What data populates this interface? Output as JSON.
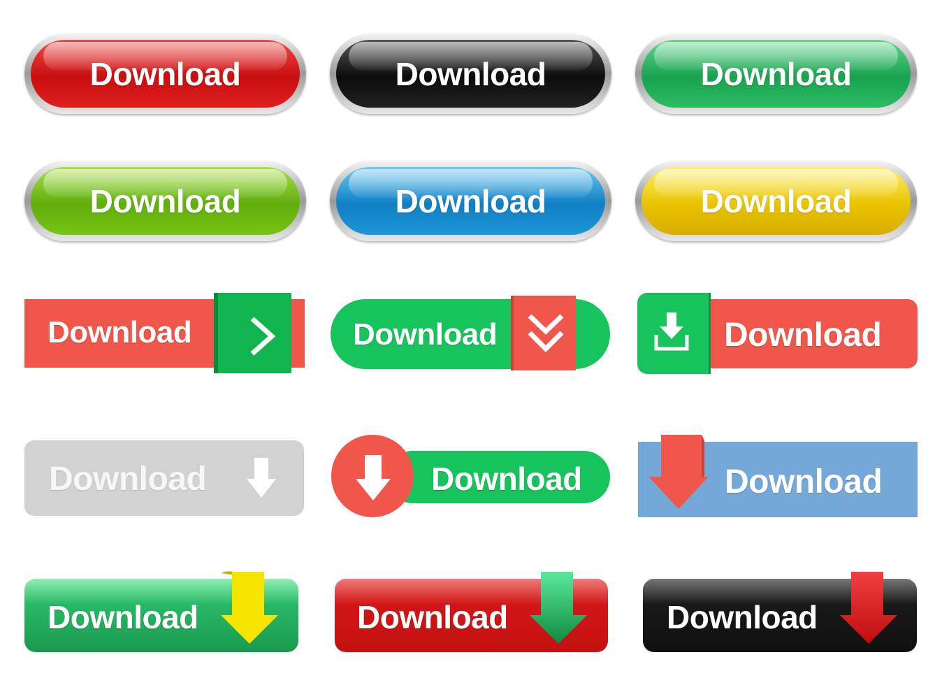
{
  "buttons": [
    {
      "label": "Download",
      "style": "glossy-pill",
      "color": "#d81818"
    },
    {
      "label": "Download",
      "style": "glossy-pill",
      "color": "#111111"
    },
    {
      "label": "Download",
      "style": "glossy-pill",
      "color": "#1fae55"
    },
    {
      "label": "Download",
      "style": "glossy-pill",
      "color": "#6fbe12"
    },
    {
      "label": "Download",
      "style": "glossy-pill",
      "color": "#1488cf"
    },
    {
      "label": "Download",
      "style": "glossy-pill",
      "color": "#efd000"
    },
    {
      "label": "Download",
      "style": "flat-tab",
      "color": "#f0574a",
      "icon": "chevron-right-icon"
    },
    {
      "label": "Download",
      "style": "flat-pill-tab",
      "color": "#17c35d",
      "icon": "double-chevron-down-icon"
    },
    {
      "label": "Download",
      "style": "flat-icon-left",
      "color": "#f0574a",
      "icon": "download-tray-icon"
    },
    {
      "label": "Download",
      "style": "flat-disabled",
      "color": "#d2d2d2",
      "icon": "arrow-down-icon"
    },
    {
      "label": "Download",
      "style": "flat-circle",
      "color": "#17c35d",
      "icon": "arrow-down-icon"
    },
    {
      "label": "Download",
      "style": "flat-arrow",
      "color": "#74a8d8",
      "icon": "arrow-down-icon"
    },
    {
      "label": "Download",
      "style": "ribbon",
      "color": "#1fae55",
      "icon": "ribbon-arrow-down-icon"
    },
    {
      "label": "Download",
      "style": "ribbon",
      "color": "#d81818",
      "icon": "ribbon-arrow-down-icon"
    },
    {
      "label": "Download",
      "style": "ribbon",
      "color": "#111111",
      "icon": "ribbon-arrow-down-icon"
    }
  ]
}
